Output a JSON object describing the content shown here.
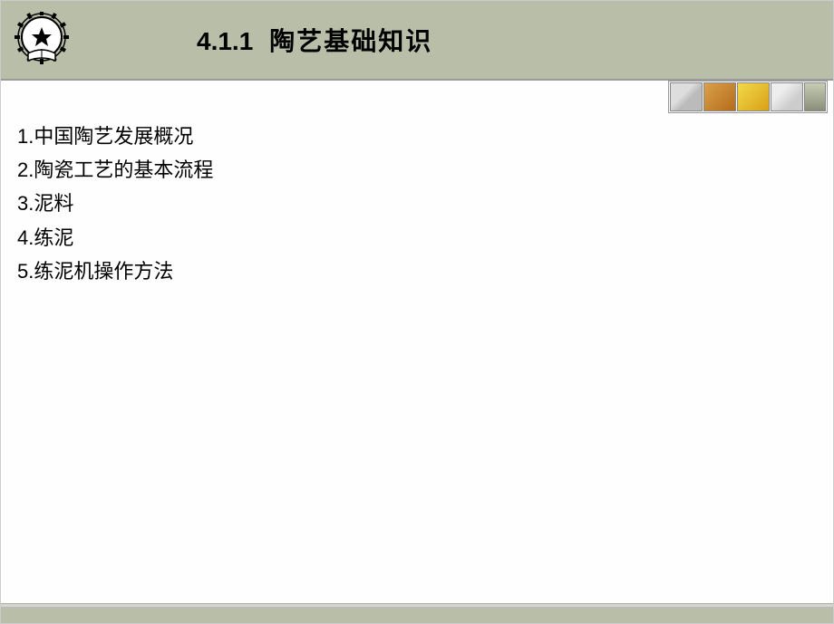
{
  "header": {
    "section_number": "4.1.1",
    "title": "陶艺基础知识"
  },
  "items": [
    "1.中国陶艺发展概况",
    "2.陶瓷工艺的基本流程",
    "3.泥料",
    "4.练泥",
    "5.练泥机操作方法"
  ]
}
